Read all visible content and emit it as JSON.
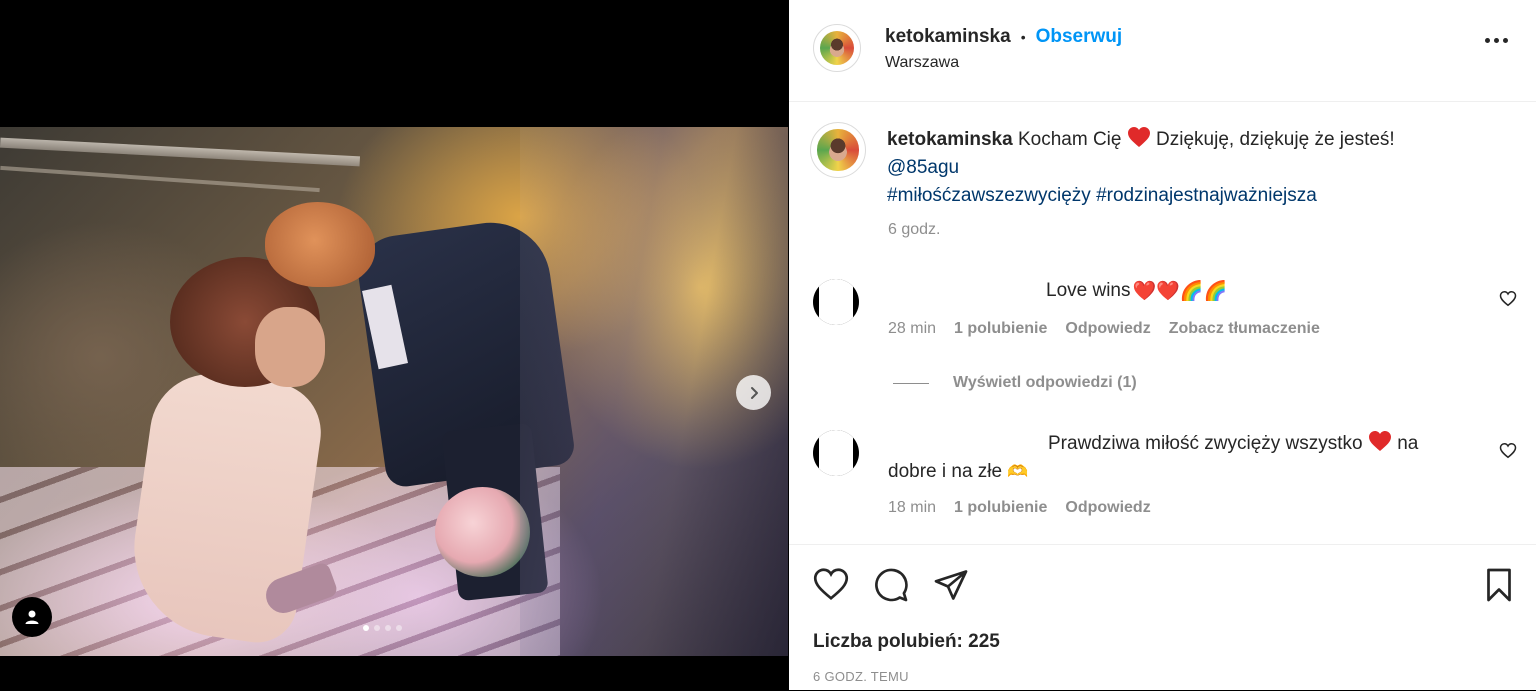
{
  "post": {
    "username": "ketokaminska",
    "separator": "•",
    "follow_label": "Obserwuj",
    "location": "Warszawa",
    "caption_text": "Kocham Cię",
    "caption_text2": "Dziękuję, dziękuję że jesteś!",
    "mention": "@85agu",
    "hashtag1": "#miłośćzawszezwycięży",
    "hashtag2": "#rodzinajestnajważniejsza",
    "caption_time": "6 godz.",
    "likes_label": "Liczba polubień: 225",
    "posted_ago": "6 GODZ. TEMU",
    "carousel": {
      "slide_count": 4,
      "active_index": 0
    }
  },
  "comments": [
    {
      "text": "Love wins",
      "emoji": "❤️❤️🌈🌈",
      "time": "28 min",
      "likes": "1 polubienie",
      "reply": "Odpowiedz",
      "translate": "Zobacz tłumaczenie",
      "view_replies": "Wyświetl odpowiedzi (1)"
    },
    {
      "text": "Prawdziwa miłość zwycięży wszystko",
      "text2": "na",
      "text3": "dobre i na złe",
      "emoji_heart": "❤️",
      "emoji_hands": "🫶",
      "time": "18 min",
      "likes": "1 polubienie",
      "reply": "Odpowiedz"
    }
  ],
  "icons": {
    "like": "heart-outline-icon",
    "comment": "comment-bubble-icon",
    "share": "paper-plane-icon",
    "save": "bookmark-icon",
    "more": "ellipsis-icon",
    "next": "chevron-right-icon",
    "user_tag": "user-icon"
  },
  "colors": {
    "accent": "#0095f6",
    "link": "#00376b",
    "muted": "#8e8e8e",
    "heart": "#ed4956"
  }
}
